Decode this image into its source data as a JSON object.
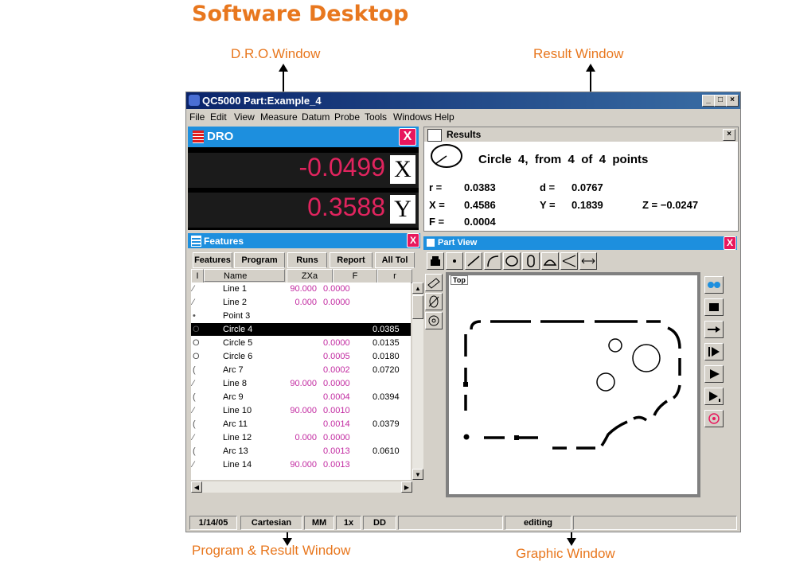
{
  "page": {
    "title": "Software Desktop",
    "callouts": {
      "dro": "D.R.O.Window",
      "result": "Result Window",
      "program": "Program & Result Window",
      "graphic": "Graphic Window"
    }
  },
  "window": {
    "title": "QC5000 Part:Example_4",
    "controls": [
      "_",
      "□",
      "×"
    ],
    "menu": [
      "File",
      "Edit",
      "View",
      "Measure",
      "Datum",
      "Probe",
      "Tools",
      "Windows",
      "Help"
    ]
  },
  "dro": {
    "title": "DRO",
    "close": "X",
    "x_value": "-0.0499",
    "x_axis": "X",
    "y_value": "0.3588",
    "y_axis": "Y"
  },
  "results": {
    "title": "Results",
    "close": "×",
    "summary": "Circle  4,  from  4  of  4  points",
    "r_label": "r =",
    "r_value": "0.0383",
    "d_label": "d =",
    "d_value": "0.0767",
    "x_label": "X =",
    "x_value": "0.4586",
    "y_label": "Y =",
    "y_value": "0.1839",
    "z_label": "Z = −0.0247",
    "f_label": "F =",
    "f_value": "0.0004"
  },
  "features": {
    "title": "Features",
    "close": "X",
    "tabs": [
      "Features",
      "Program",
      "Runs",
      "Report",
      "All Tol"
    ],
    "columns": [
      "I",
      "Name",
      "ZXa",
      "F",
      "r"
    ],
    "rows": [
      {
        "icon": "line",
        "name": "Line  1",
        "zxa": "90.000",
        "f": "0.0000",
        "r": ""
      },
      {
        "icon": "line",
        "name": "Line  2",
        "zxa": "0.000",
        "f": "0.0000",
        "r": ""
      },
      {
        "icon": "point",
        "name": "Point 3",
        "zxa": "",
        "f": "",
        "r": ""
      },
      {
        "icon": "circle",
        "name": "Circle 4",
        "zxa": "",
        "f": "",
        "r": "0.0385",
        "selected": true
      },
      {
        "icon": "circle",
        "name": "Circle 5",
        "zxa": "",
        "f": "0.0000",
        "r": "0.0135"
      },
      {
        "icon": "circle",
        "name": "Circle 6",
        "zxa": "",
        "f": "0.0005",
        "r": "0.0180"
      },
      {
        "icon": "arc",
        "name": "Arc 7",
        "zxa": "",
        "f": "0.0002",
        "r": "0.0720"
      },
      {
        "icon": "line",
        "name": "Line 8",
        "zxa": "90.000",
        "f": "0.0000",
        "r": ""
      },
      {
        "icon": "arc",
        "name": "Arc 9",
        "zxa": "",
        "f": "0.0004",
        "r": "0.0394"
      },
      {
        "icon": "line",
        "name": "Line 10",
        "zxa": "90.000",
        "f": "0.0010",
        "r": ""
      },
      {
        "icon": "arc",
        "name": "Arc 11",
        "zxa": "",
        "f": "0.0014",
        "r": "0.0379"
      },
      {
        "icon": "line",
        "name": "Line 12",
        "zxa": "0.000",
        "f": "0.0000",
        "r": ""
      },
      {
        "icon": "arc",
        "name": "Arc 13",
        "zxa": "",
        "f": "0.0013",
        "r": "0.0610"
      },
      {
        "icon": "line",
        "name": "Line 14",
        "zxa": "90.000",
        "f": "0.0013",
        "r": ""
      }
    ]
  },
  "partview": {
    "title": "Part View",
    "close": "X",
    "view_label": "Top",
    "toolbar_icons": [
      "probe-icon",
      "point-icon",
      "line-icon",
      "arc-icon",
      "circle-icon",
      "slot-icon",
      "distance-icon",
      "angle-icon",
      "width-icon"
    ],
    "side_left_icons": [
      "square-icon",
      "diameter-icon",
      "target-icon"
    ],
    "side_right_icons": [
      "binoculars-icon",
      "stop-icon",
      "step-icon",
      "pause-play-icon",
      "play-icon",
      "play-step-icon",
      "target-circle-icon"
    ]
  },
  "status": {
    "date": "1/14/05",
    "coords": "Cartesian",
    "units": "MM",
    "zoom": "1x",
    "format": "DD",
    "mode": "editing"
  },
  "colors": {
    "accent_orange": "#e8771e",
    "panel_blue": "#1d8fde",
    "dro_red": "#e0245e",
    "close_pink": "#e8175d",
    "value_magenta": "#c22aa1"
  }
}
